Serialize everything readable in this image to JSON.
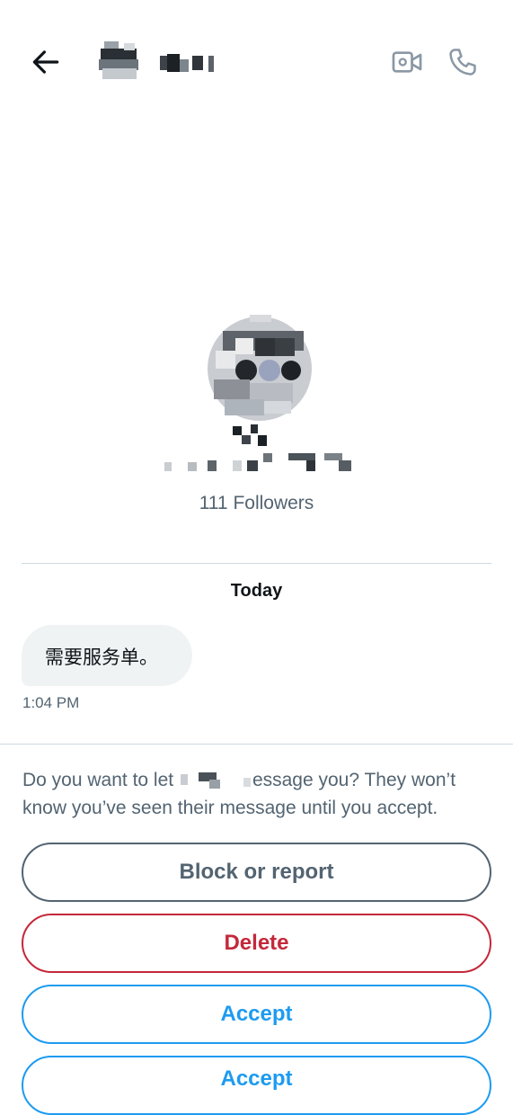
{
  "header": {
    "back_icon": "arrow-left-icon",
    "video_icon": "video-call-icon",
    "phone_icon": "phone-icon"
  },
  "profile": {
    "followers": "111 Followers"
  },
  "conversation": {
    "date_label": "Today",
    "messages": [
      {
        "text": "需要服务单。",
        "time": "1:04 PM"
      }
    ]
  },
  "request_panel": {
    "prompt_start": "Do you want to let",
    "prompt_end": "essage you? They won’t know you’ve seen their message until you accept.",
    "buttons": {
      "block": "Block or report",
      "delete": "Delete",
      "accept": "Accept",
      "accept_partial": "Accept"
    }
  },
  "colors": {
    "accent": "#1d9bf0",
    "danger": "#c4283a",
    "muted": "#536471",
    "bubble": "#eff3f4"
  }
}
